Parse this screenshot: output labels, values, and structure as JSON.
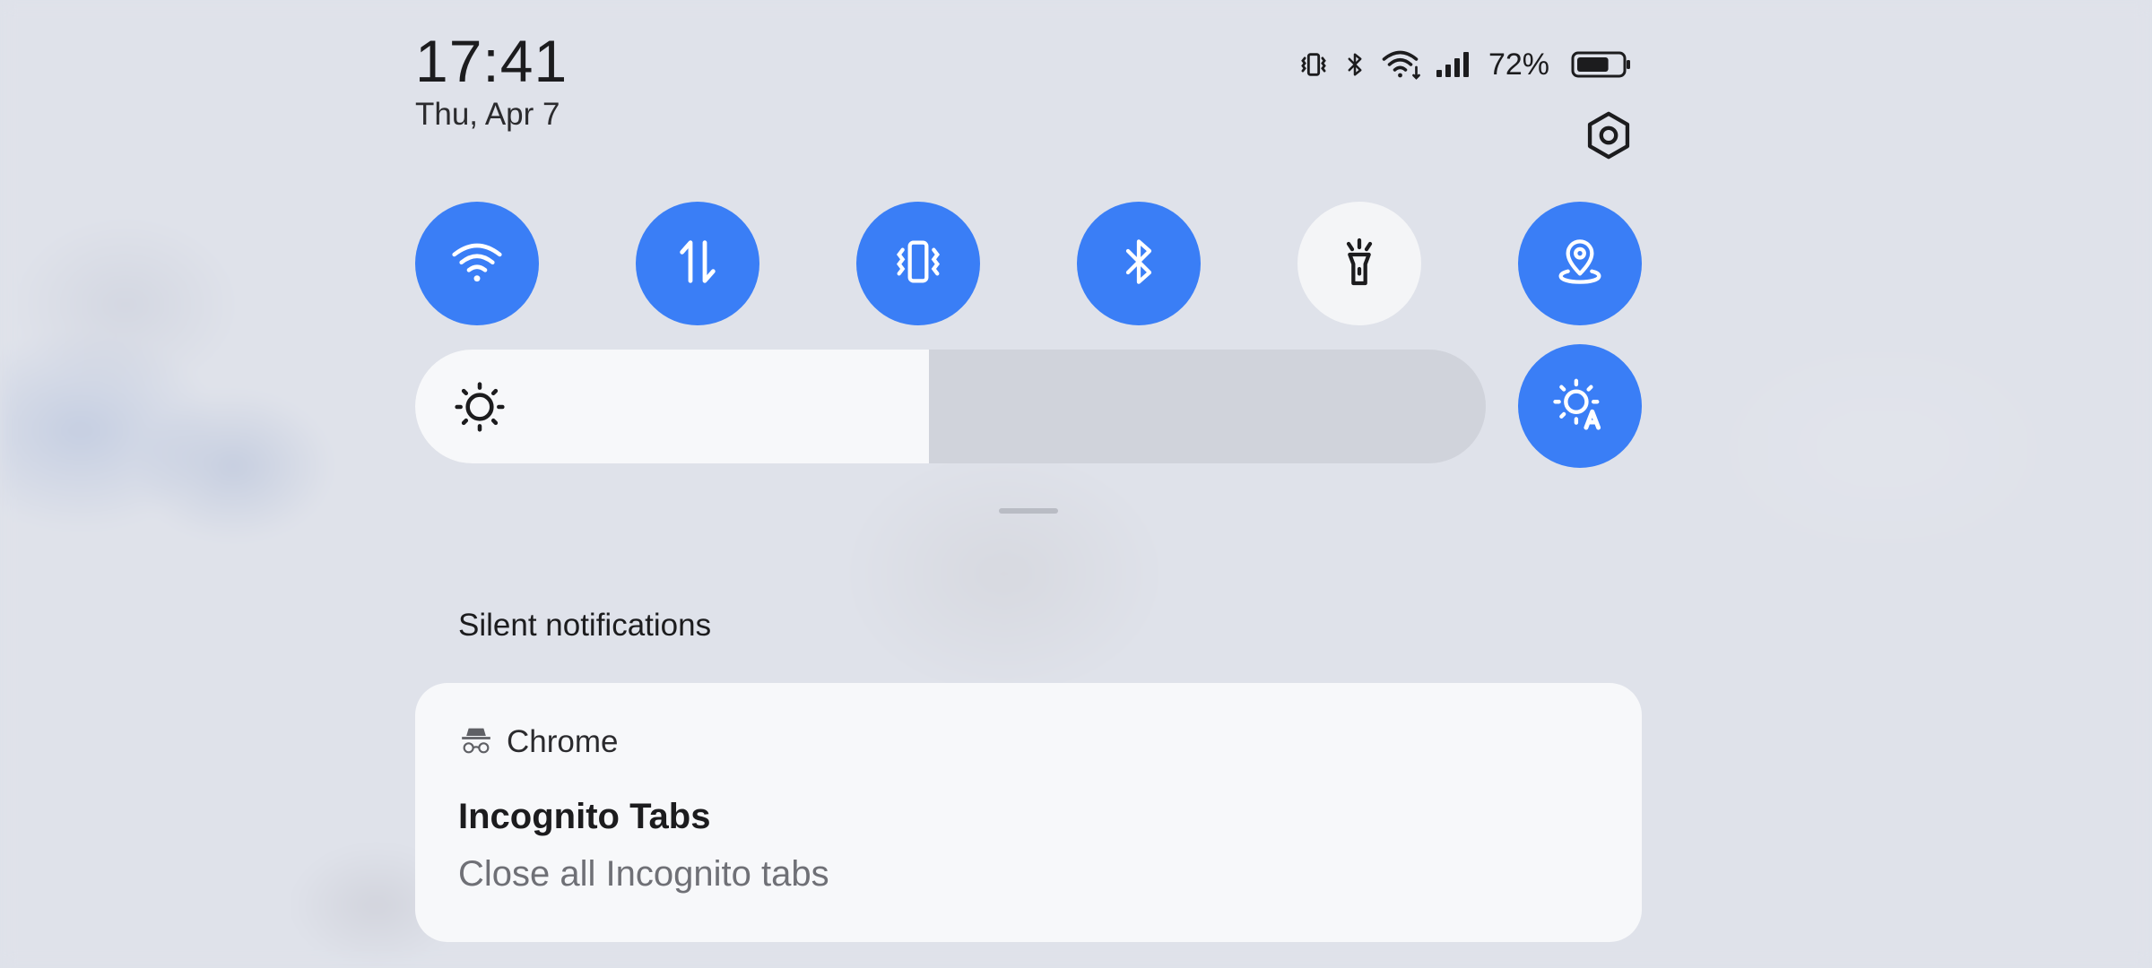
{
  "clock": {
    "time": "17:41",
    "date": "Thu, Apr 7"
  },
  "status_bar": {
    "icons": [
      "vibrate-icon",
      "bluetooth-icon",
      "wifi-icon",
      "cellular-signal-icon",
      "battery-icon"
    ],
    "battery_percent": "72%",
    "battery_level": 0.72
  },
  "settings": {
    "icon": "gear-icon"
  },
  "quick_tiles": [
    {
      "name": "wifi",
      "icon": "wifi-icon",
      "active": true
    },
    {
      "name": "mobile-data",
      "icon": "data-arrows-icon",
      "active": true
    },
    {
      "name": "vibrate",
      "icon": "vibrate-icon",
      "active": true
    },
    {
      "name": "bluetooth",
      "icon": "bluetooth-icon",
      "active": true
    },
    {
      "name": "flashlight",
      "icon": "flashlight-icon",
      "active": false
    },
    {
      "name": "location",
      "icon": "location-icon",
      "active": true
    },
    {
      "name": "auto-brightness",
      "icon": "auto-brightness-icon",
      "active": true
    }
  ],
  "brightness": {
    "icon": "sun-icon",
    "level": 0.48
  },
  "colors": {
    "accent": "#3a7ef6",
    "tile_off": "#f4f5f7",
    "background": "#dfe2ea"
  },
  "notifications": {
    "section_title": "Silent notifications",
    "items": [
      {
        "app_icon": "incognito-icon",
        "app_name": "Chrome",
        "title": "Incognito Tabs",
        "body": "Close all Incognito tabs"
      }
    ]
  }
}
